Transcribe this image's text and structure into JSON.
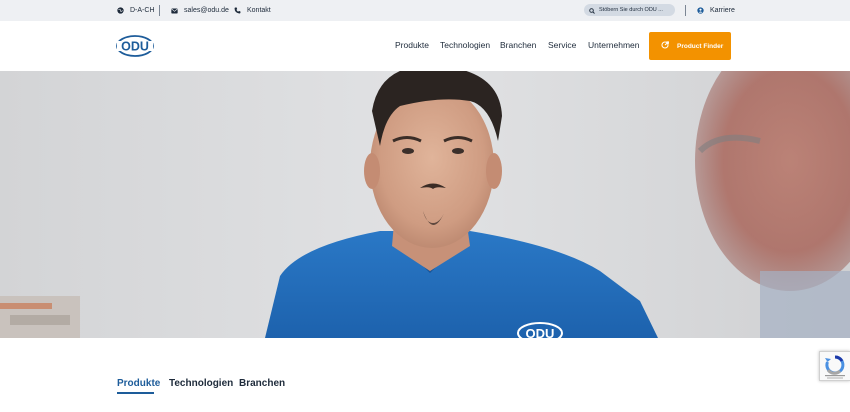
{
  "topbar": {
    "region_label": "D-A-CH",
    "email_label": "sales@odu.de",
    "contact_label": "Kontakt",
    "search_placeholder": "Stöbern Sie durch ODU ...",
    "career_label": "Karriere"
  },
  "header": {
    "logo_text": "ODU",
    "nav": [
      "Produkte",
      "Technologien",
      "Branchen",
      "Service",
      "Unternehmen"
    ],
    "product_finder_label": "Product Finder"
  },
  "hero": {
    "shirt_logo_text": "ODU"
  },
  "tabs": {
    "items": [
      "Produkte",
      "Technologien",
      "Branchen"
    ],
    "active": "Produkte"
  },
  "colors": {
    "brand_blue": "#1d5c9a",
    "accent_orange": "#f39200",
    "topbar_bg": "#eef0f3",
    "text_dark": "#1d2a3a"
  },
  "icons": [
    "globe-icon",
    "mail-icon",
    "phone-icon",
    "search-icon",
    "career-icon",
    "product-finder-icon",
    "recaptcha-icon"
  ]
}
